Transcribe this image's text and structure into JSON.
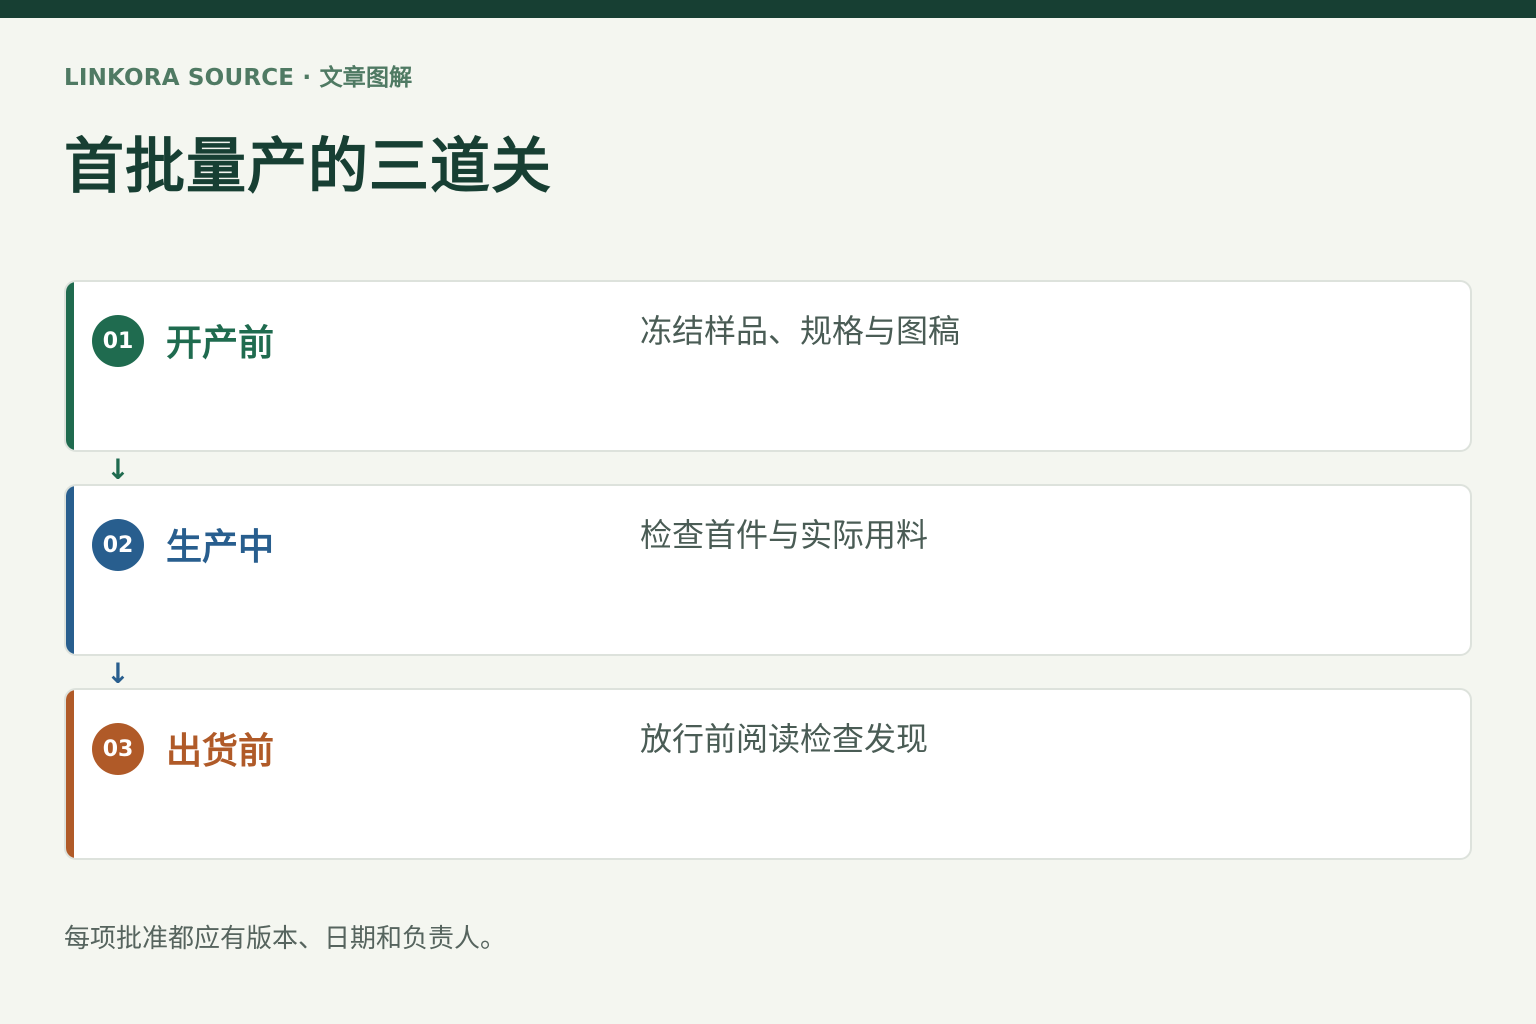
{
  "header": {
    "kicker": "LINKORA SOURCE · 文章图解",
    "title": "首批量产的三道关"
  },
  "steps": [
    {
      "number": "01",
      "name": "开产前",
      "description": "冻结样品、规格与图稿",
      "color": "#1f6b4f"
    },
    {
      "number": "02",
      "name": "生产中",
      "description": "检查首件与实际用料",
      "color": "#285e8e"
    },
    {
      "number": "03",
      "name": "出货前",
      "description": "放行前阅读检查发现",
      "color": "#b05a28"
    }
  ],
  "arrows": [
    {
      "glyph": "↓",
      "color": "#1f6b4f"
    },
    {
      "glyph": "↓",
      "color": "#285e8e"
    }
  ],
  "footer": {
    "note": "每项批准都应有版本、日期和负责人。"
  }
}
